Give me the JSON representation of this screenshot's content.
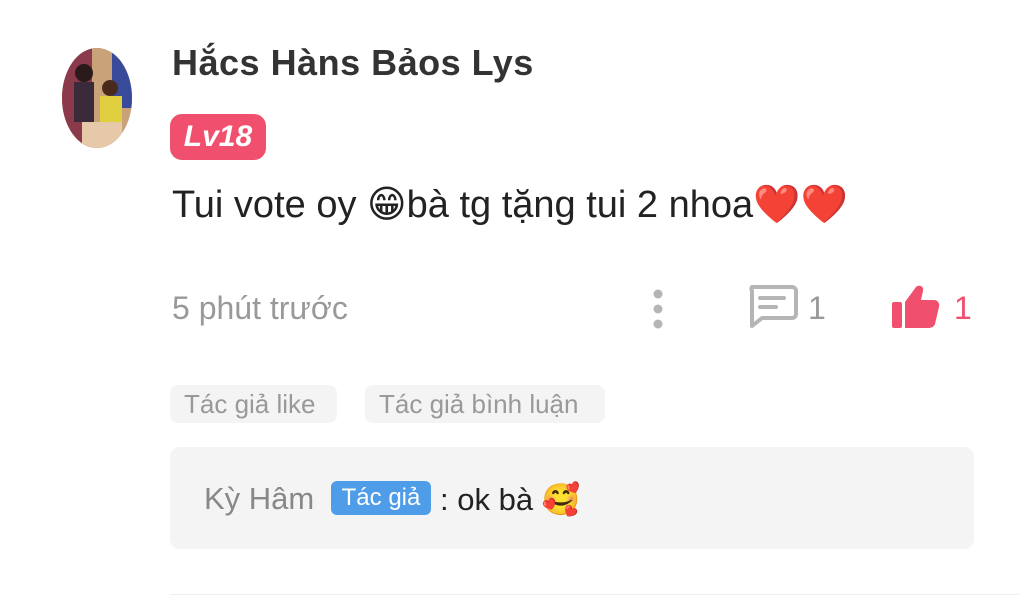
{
  "comment": {
    "username": "Hắcs Hàns Bảos Lys",
    "level": "Lv18",
    "text": "Tui vote oy 😁bà tg tặng tui 2 nhoa❤️❤️",
    "timestamp": "5 phút trước",
    "reply_count": "1",
    "like_count": "1",
    "tags": [
      "Tác giả like",
      "Tác giả bình luận"
    ]
  },
  "reply": {
    "author": "Kỳ Hâm",
    "author_badge": "Tác giả",
    "text": ": ok bà 🥰"
  },
  "colors": {
    "accent_pink": "#f0506e",
    "author_blue": "#4f9de8",
    "muted_gray": "#999999"
  },
  "icons": {
    "more": "more-vertical-icon",
    "reply": "comment-bubble-icon",
    "like": "thumbs-up-icon"
  }
}
